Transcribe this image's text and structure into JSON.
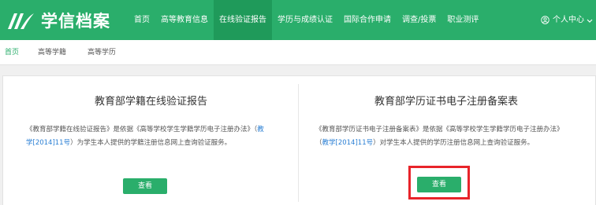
{
  "logo": {
    "text": "学信档案"
  },
  "nav": [
    {
      "label": "首页"
    },
    {
      "label": "高等教育信息"
    },
    {
      "label": "在线验证报告",
      "active": true
    },
    {
      "label": "学历与成绩认证"
    },
    {
      "label": "国际合作申请"
    },
    {
      "label": "调查/投票"
    },
    {
      "label": "职业测评"
    }
  ],
  "user": {
    "label": "个人中心"
  },
  "subnav": [
    {
      "label": "首页",
      "active": true
    },
    {
      "label": "高等学籍"
    },
    {
      "label": "高等学历"
    }
  ],
  "cards": [
    {
      "title": "教育部学籍在线验证报告",
      "desc_pre": "《教育部学籍在线验证报告》是依据《高等学校学生学籍学历电子注册办法》（",
      "desc_link": "教学[2014]11号",
      "desc_post": "）为学生本人提供的学籍注册信息网上查询验证服务。",
      "button": "查看"
    },
    {
      "title": "教育部学历证书电子注册备案表",
      "desc_pre": "《教育部学历证书电子注册备案表》是依据《高等学校学生学籍学历电子注册办法》（",
      "desc_link": "教学[2014]11号",
      "desc_post": "）对学生本人提供的学历注册信息网上查询验证服务。",
      "button": "查看"
    }
  ],
  "colors": {
    "brand": "#2aae6b",
    "link": "#2a7fd4",
    "highlight": "#e8242a"
  }
}
